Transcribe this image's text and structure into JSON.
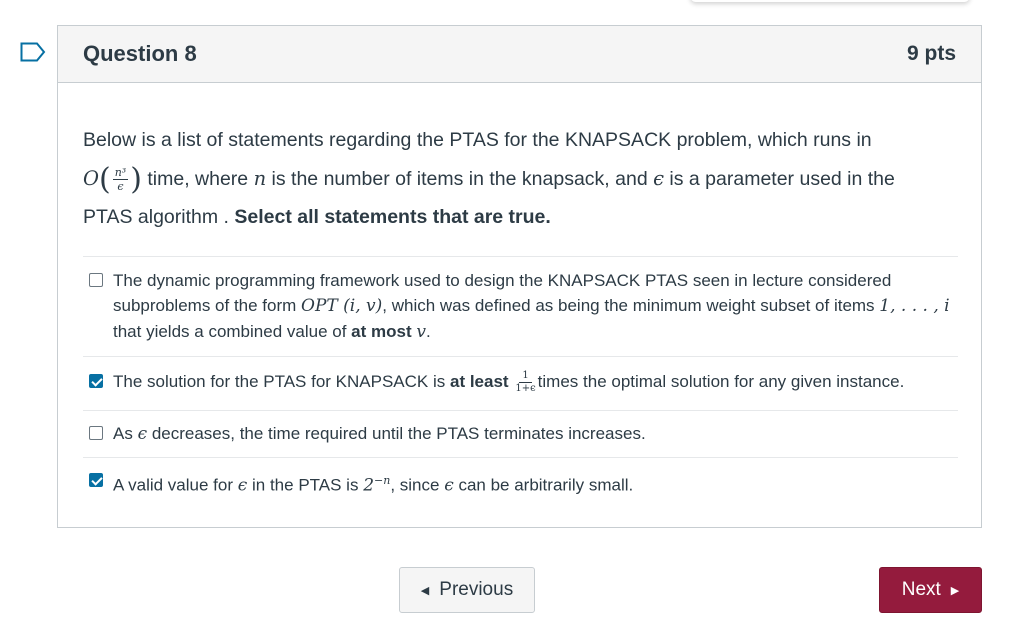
{
  "question": {
    "title": "Question 8",
    "points": "9 pts",
    "stem": {
      "line1": "Below is a list of statements regarding the PTAS for the KNAPSACK problem, which runs in",
      "big_o": "O",
      "frac_num": "n³",
      "frac_den": "ϵ",
      "line2_a": " time, where ",
      "var_n": "n",
      "line2_b": " is the number of items in the knapsack, and ",
      "var_eps": "ϵ",
      "line2_c": " is a parameter used in the",
      "line3_a": "PTAS algorithm . ",
      "line3_bold": "Select all statements that are true."
    }
  },
  "answers": [
    {
      "checked": false,
      "text_a": "The dynamic programming framework used to design the KNAPSACK PTAS seen in lecture considered subproblems of the form ",
      "math_a": "OPT (i, v)",
      "text_b": ", which was defined as being the minimum weight subset of items ",
      "math_b": "1, . . . , i",
      "text_c": " that yields a combined value of ",
      "bold": "at most",
      "math_c": "v",
      "text_d": "."
    },
    {
      "checked": true,
      "text_a": "The solution for the PTAS for KNAPSACK is ",
      "bold": "at least",
      "frac_num": "1",
      "frac_den": "1+ϵ",
      "text_b": "times the optimal solution for any given instance."
    },
    {
      "checked": false,
      "text_a": "As ",
      "math_a": "ϵ",
      "text_b": " decreases, the time required until the PTAS terminates increases."
    },
    {
      "checked": true,
      "text_a": "A valid value for ",
      "math_a": "ϵ",
      "text_b": " in the PTAS is ",
      "math_b": "2",
      "sup": "−n",
      "text_c": ", since ",
      "math_c": "ϵ",
      "text_d": " can be arbitrarily small."
    }
  ],
  "nav": {
    "previous_label": "Previous",
    "next_label": "Next"
  },
  "icons": {
    "flag": "bookmark-flag-icon",
    "prev_arrow": "triangle-left-icon",
    "next_arrow": "triangle-right-icon"
  },
  "colors": {
    "accent_checkbox": "#0770a3",
    "next_button": "#941b3d",
    "flag_outline": "#0770a3"
  }
}
